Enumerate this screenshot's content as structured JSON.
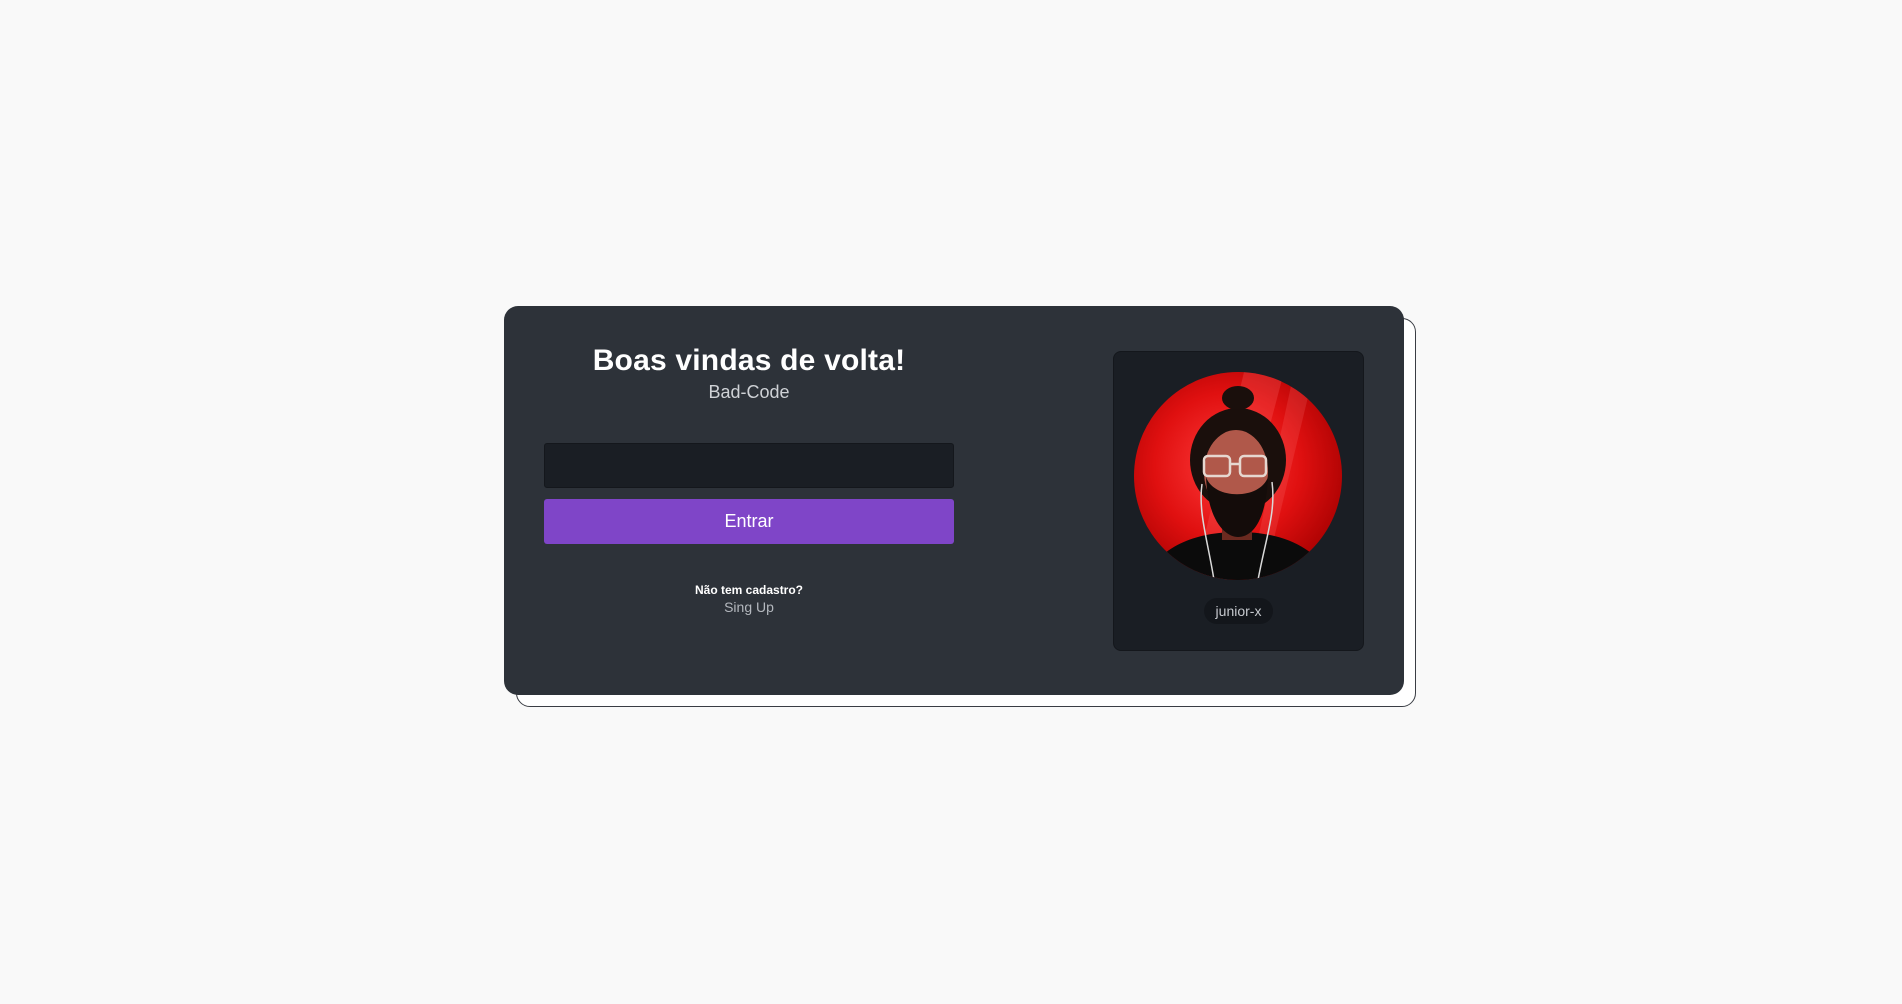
{
  "login": {
    "title": "Boas vindas de volta!",
    "subtitle": "Bad-Code",
    "input_value": "",
    "input_placeholder": "",
    "submit_label": "Entrar",
    "signup_prompt": "Não tem cadastro?",
    "signup_link": "Sing Up"
  },
  "profile": {
    "username": "junior-x",
    "avatar_icon": "user-avatar-photo"
  },
  "colors": {
    "page_background": "#f9f9f9",
    "card_background": "#2d3239",
    "input_background": "#1a1e24",
    "accent": "#7f45c8",
    "avatar_red": "#e01010"
  }
}
